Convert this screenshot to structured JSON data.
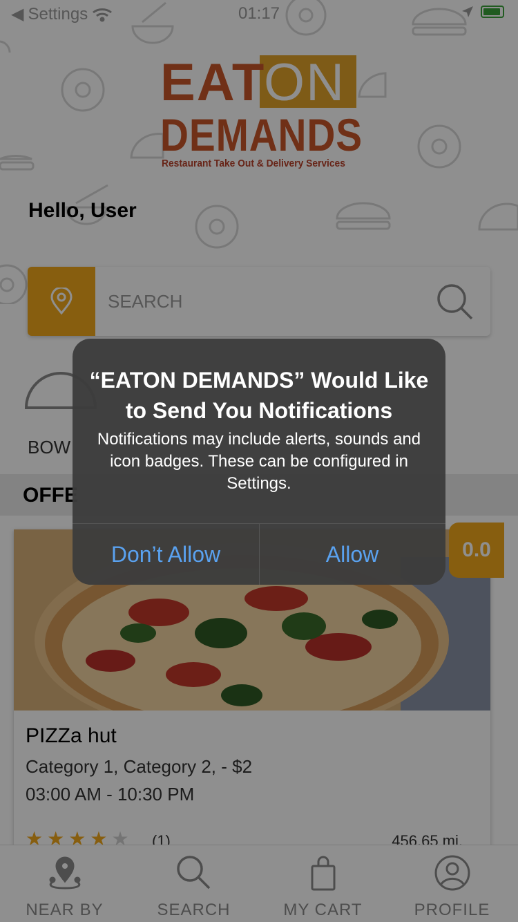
{
  "status_bar": {
    "back_label": "Settings",
    "time": "01:17"
  },
  "logo": {
    "word_eat": "EAT",
    "word_on": "ON",
    "word_demands": "DEMANDS",
    "tagline": "Restaurant Take Out & Delivery Services"
  },
  "greeting": "Hello, User",
  "search": {
    "placeholder": "SEARCH"
  },
  "categories": [
    {
      "label": "BOW",
      "icon": "bowl-icon"
    }
  ],
  "offers": {
    "title": "OFFE"
  },
  "restaurant": {
    "rating": "0.0",
    "name": "PIZZa hut",
    "categories": "Category 1, Category 2,  - $2",
    "hours": "03:00 AM - 10:30 PM",
    "stars": 4,
    "star_max": 5,
    "reviews": "(1)",
    "distance": "456.65 mi."
  },
  "tabs": [
    {
      "label": "NEAR BY",
      "icon": "map-pin-icon"
    },
    {
      "label": "SEARCH",
      "icon": "search-icon"
    },
    {
      "label": "MY CART",
      "icon": "shopping-bag-icon"
    },
    {
      "label": "PROFILE",
      "icon": "user-icon"
    }
  ],
  "alert": {
    "title": "“EATON DEMANDS” Would Like to Send You Notifications",
    "message": "Notifications may include alerts, sounds and icon badges. These can be configured in Settings.",
    "deny_label": "Don’t Allow",
    "allow_label": "Allow"
  },
  "colors": {
    "accent": "#f0a81c",
    "brand_red": "#c8562a",
    "alert_button": "#5aa2f0"
  }
}
